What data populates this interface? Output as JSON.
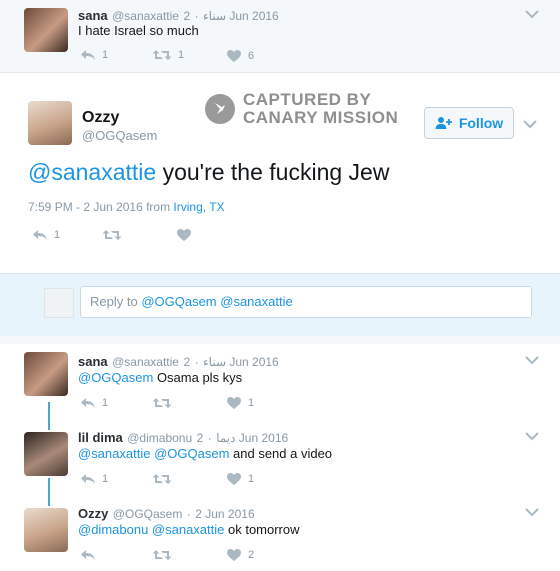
{
  "tweet1": {
    "name": "sana",
    "handle": "@sanaxattie",
    "display_ar": "سناء",
    "date": "2 Jun 2016",
    "text": "I hate Israel so much",
    "replies": "1",
    "retweets": "1",
    "likes": "6"
  },
  "watermark": {
    "line1": "CAPTURED BY",
    "line2": "CANARY MISSION"
  },
  "main": {
    "name": "Ozzy",
    "handle": "@OGQasem",
    "follow_label": "Follow",
    "mention": "@sanaxattie",
    "text": " you're the fucking Jew",
    "time": "7:59 PM - 2 Jun 2016 from ",
    "location": "Irving, TX",
    "replies": "1"
  },
  "reply_box": {
    "prefix": "Reply to ",
    "mentions": "@OGQasem @sanaxattie"
  },
  "reply1": {
    "name": "sana",
    "handle": "@sanaxattie",
    "display_ar": "سناء",
    "date": "2 Jun 2016",
    "mention": "@OGQasem",
    "text": " Osama pls kys",
    "replies": "1",
    "likes": "1"
  },
  "reply2": {
    "name": "lil dima",
    "handle": "@dimabonu",
    "display_ar": "ديما",
    "date": "2 Jun 2016",
    "mention": "@sanaxattie @OGQasem",
    "text": " and send a video",
    "replies": "1",
    "likes": "1"
  },
  "reply3": {
    "name": "Ozzy",
    "handle": "@OGQasem",
    "date": "2 Jun 2016",
    "mention": "@dimabonu @sanaxattie",
    "text": " ok tomorrow",
    "likes": "2"
  },
  "icons": [
    "reply-icon",
    "retweet-icon",
    "heart-icon",
    "chevron-down-icon",
    "follow-person-icon",
    "canary-bird-icon"
  ],
  "colors": {
    "link": "#1b95e0",
    "bg_blue": "#f5f8fa",
    "border": "#e1e8ed",
    "thread": "#4ea3c9"
  }
}
